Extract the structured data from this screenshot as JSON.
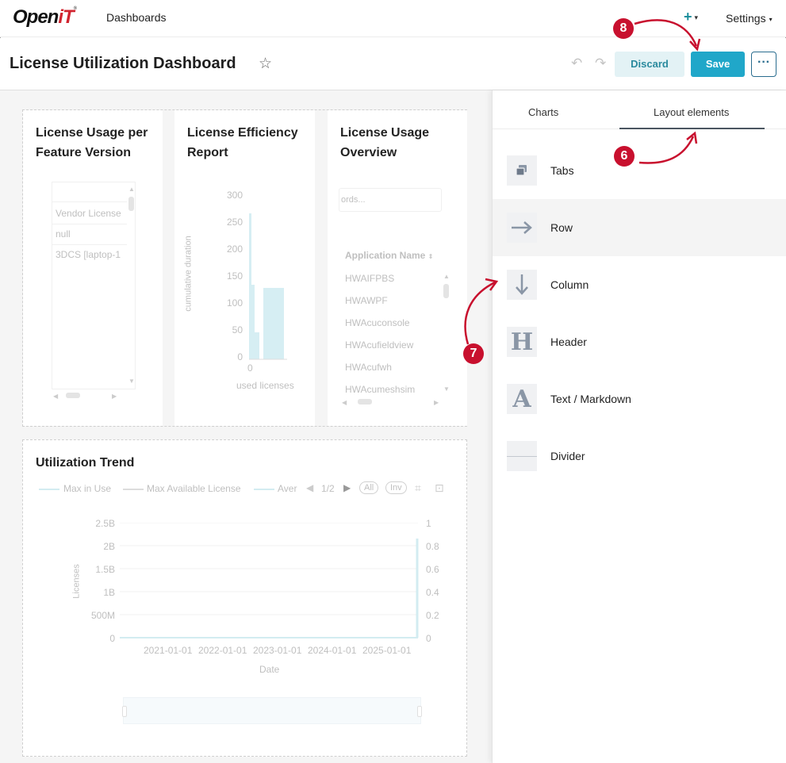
{
  "nav": {
    "logo_main": "Open",
    "logo_it": "iT",
    "logo_mark": "®",
    "dashboards_link": "Dashboards",
    "plus_icon": "plus-icon",
    "settings_label": "Settings"
  },
  "header": {
    "title": "License Utilization Dashboard",
    "star_icon": "star-icon",
    "undo_icon": "undo-icon",
    "redo_icon": "redo-icon",
    "discard_label": "Discard",
    "save_label": "Save",
    "more_label": "···"
  },
  "colors": {
    "accent": "#20a7c9",
    "discard_bg": "#e3f2f5",
    "badge": "#c8102e"
  },
  "cards": [
    {
      "title_line1": "License Usage per",
      "title_line2": "Feature Version",
      "rows": [
        "Vendor License",
        "null",
        "3DCS [laptop-1"
      ]
    },
    {
      "title_line1": "License Efficiency",
      "title_line2": "Report",
      "y_ticks": [
        "300",
        "250",
        "200",
        "150",
        "100",
        "50",
        "0"
      ],
      "y_label": "cumulative duration",
      "x_tick": "0",
      "x_label": "used licenses"
    },
    {
      "title_line1": "License Usage",
      "title_line2": "Overview",
      "search_placeholder": "ords...",
      "column_header": "Application Name",
      "rows": [
        "HWAIFPBS",
        "HWAWPF",
        "HWAcuconsole",
        "HWAcufieldview",
        "HWAcufwh",
        "HWAcumeshsim"
      ]
    }
  ],
  "trend": {
    "title": "Utilization Trend",
    "legend": [
      "Max in Use",
      "Max Available License",
      "Aver"
    ],
    "pager": "1/2",
    "all_label": "All",
    "inv_label": "Inv",
    "y_left_ticks": [
      "2.5B",
      "2B",
      "1.5B",
      "1B",
      "500M",
      "0"
    ],
    "y_right_ticks": [
      "1",
      "0.8",
      "0.6",
      "0.4",
      "0.2",
      "0"
    ],
    "y_label": "Licenses",
    "x_ticks": [
      "2021-01-01",
      "2022-01-01",
      "2023-01-01",
      "2024-01-01",
      "2025-01-01"
    ],
    "x_label": "Date"
  },
  "panel": {
    "tabs": [
      "Charts",
      "Layout elements"
    ],
    "active_tab": "Layout elements",
    "items": [
      {
        "label": "Tabs",
        "icon": "tabs-icon"
      },
      {
        "label": "Row",
        "icon": "arrow-right-icon"
      },
      {
        "label": "Column",
        "icon": "arrow-down-icon"
      },
      {
        "label": "Header",
        "icon": "header-icon"
      },
      {
        "label": "Text / Markdown",
        "icon": "text-icon"
      },
      {
        "label": "Divider",
        "icon": "divider-icon"
      }
    ]
  },
  "annotations": [
    "6",
    "7",
    "8"
  ]
}
